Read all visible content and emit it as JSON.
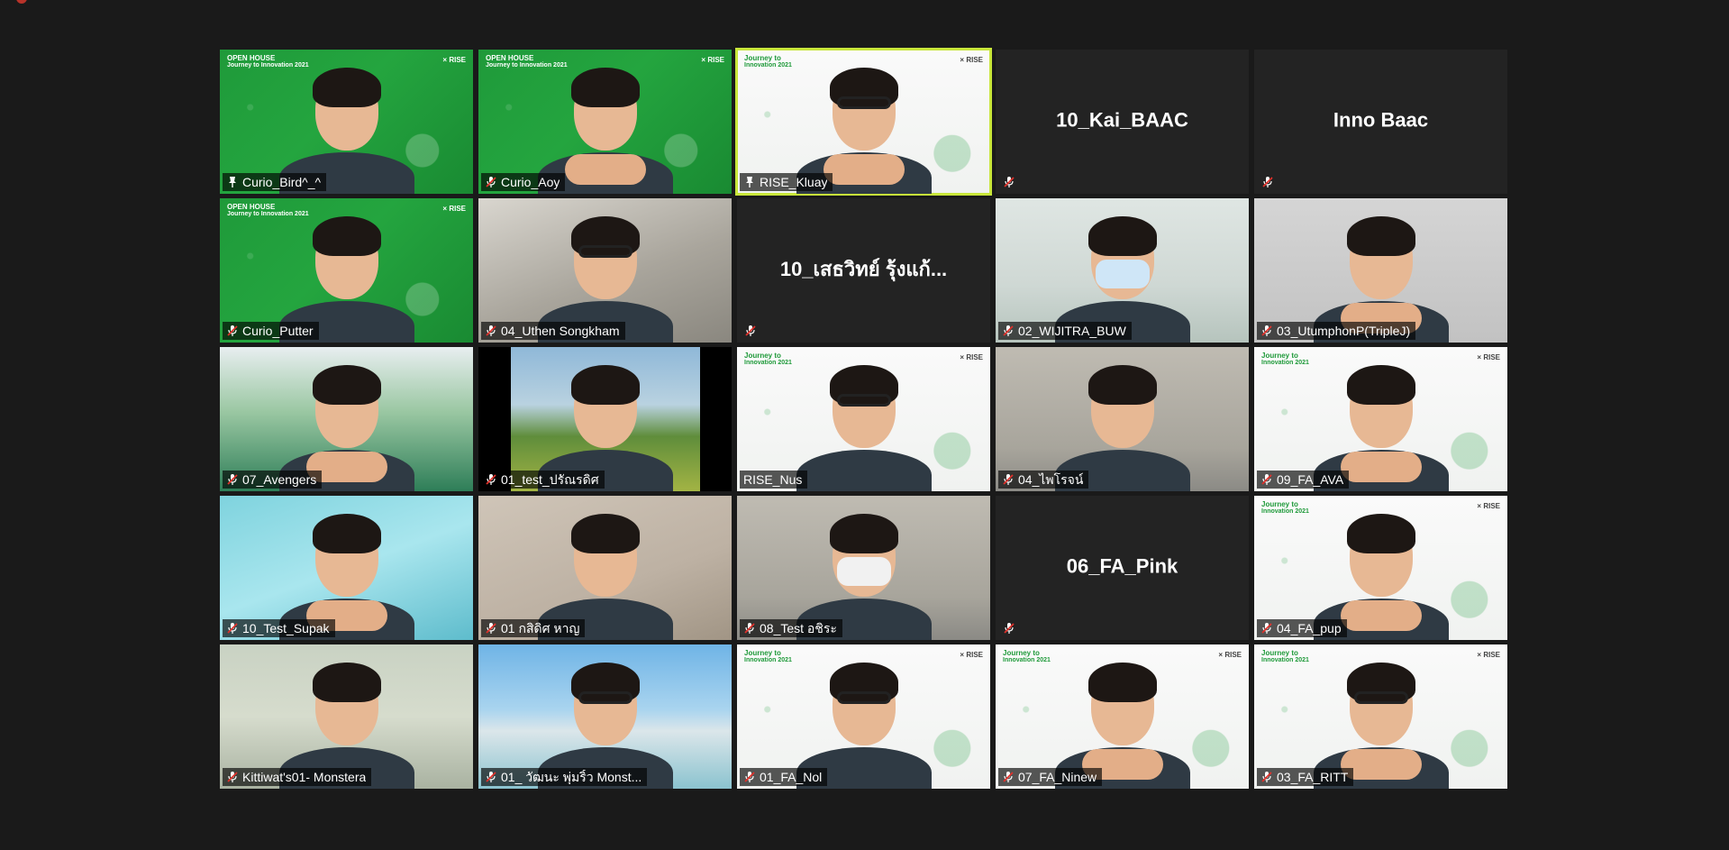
{
  "window": {
    "recording_indicator": "recording-dot"
  },
  "banner": {
    "green_line1": "OPEN HOUSE",
    "green_line2": "Journey to Innovation 2021",
    "white_line1": "Journey to",
    "white_line2": "Innovation 2021",
    "logos": "× RISE"
  },
  "participants": [
    {
      "name": "Curio_Bird^_^",
      "status_icon": "pin-icon",
      "bg": "green"
    },
    {
      "name": "Curio_Aoy",
      "status_icon": "mic-off-icon",
      "bg": "green"
    },
    {
      "name": "RISE_Kluay",
      "status_icon": "pin-icon",
      "bg": "white",
      "active_speaker": true
    },
    {
      "name": "10_Kai_BAAC",
      "status_icon": "mic-off-icon",
      "bg": "none",
      "video_off": true
    },
    {
      "name": "Inno Baac",
      "status_icon": "mic-off-icon",
      "bg": "none",
      "video_off": true
    },
    {
      "name": "Curio_Putter",
      "status_icon": "mic-off-icon",
      "bg": "green"
    },
    {
      "name": "04_Uthen Songkham",
      "status_icon": "mic-off-icon",
      "bg": "office"
    },
    {
      "name": "10_เสธวิทย์ รุ้งแก้...",
      "status_icon": "mic-off-icon",
      "bg": "none",
      "video_off": true
    },
    {
      "name": "02_WIJITRA_BUW",
      "status_icon": "mic-off-icon",
      "bg": "room"
    },
    {
      "name": "03_UtumphonP(TripleJ)",
      "status_icon": "mic-off-icon",
      "bg": "grey"
    },
    {
      "name": "07_Avengers",
      "status_icon": "mic-off-icon",
      "bg": "meeting"
    },
    {
      "name": "01_test_ปรัณรดิศ",
      "status_icon": "mic-off-icon",
      "bg": "field"
    },
    {
      "name": "RISE_Nus",
      "status_icon": "",
      "bg": "white"
    },
    {
      "name": "04_ไพโรจน์",
      "status_icon": "mic-off-icon",
      "bg": "warm"
    },
    {
      "name": "09_FA_AVA",
      "status_icon": "mic-off-icon",
      "bg": "white"
    },
    {
      "name": "10_Test_Supak",
      "status_icon": "mic-off-icon",
      "bg": "teal"
    },
    {
      "name": "01 กสิดิศ หาญ",
      "status_icon": "mic-off-icon",
      "bg": "beige"
    },
    {
      "name": "08_Test อชิระ",
      "status_icon": "mic-off-icon",
      "bg": "warm"
    },
    {
      "name": "06_FA_Pink",
      "status_icon": "mic-off-icon",
      "bg": "none",
      "video_off": true
    },
    {
      "name": "04_FA_pup",
      "status_icon": "mic-off-icon",
      "bg": "white"
    },
    {
      "name": "Kittiwat's01- Monstera",
      "status_icon": "mic-off-icon",
      "bg": "kitchen"
    },
    {
      "name": "01_ วัฒนะ พุ่มริ้ว Monst...",
      "status_icon": "mic-off-icon",
      "bg": "beach"
    },
    {
      "name": "01_FA_Nol",
      "status_icon": "mic-off-icon",
      "bg": "white"
    },
    {
      "name": "07_FA_Ninew",
      "status_icon": "mic-off-icon",
      "bg": "white"
    },
    {
      "name": "03_FA_RITT",
      "status_icon": "mic-off-icon",
      "bg": "white"
    }
  ]
}
